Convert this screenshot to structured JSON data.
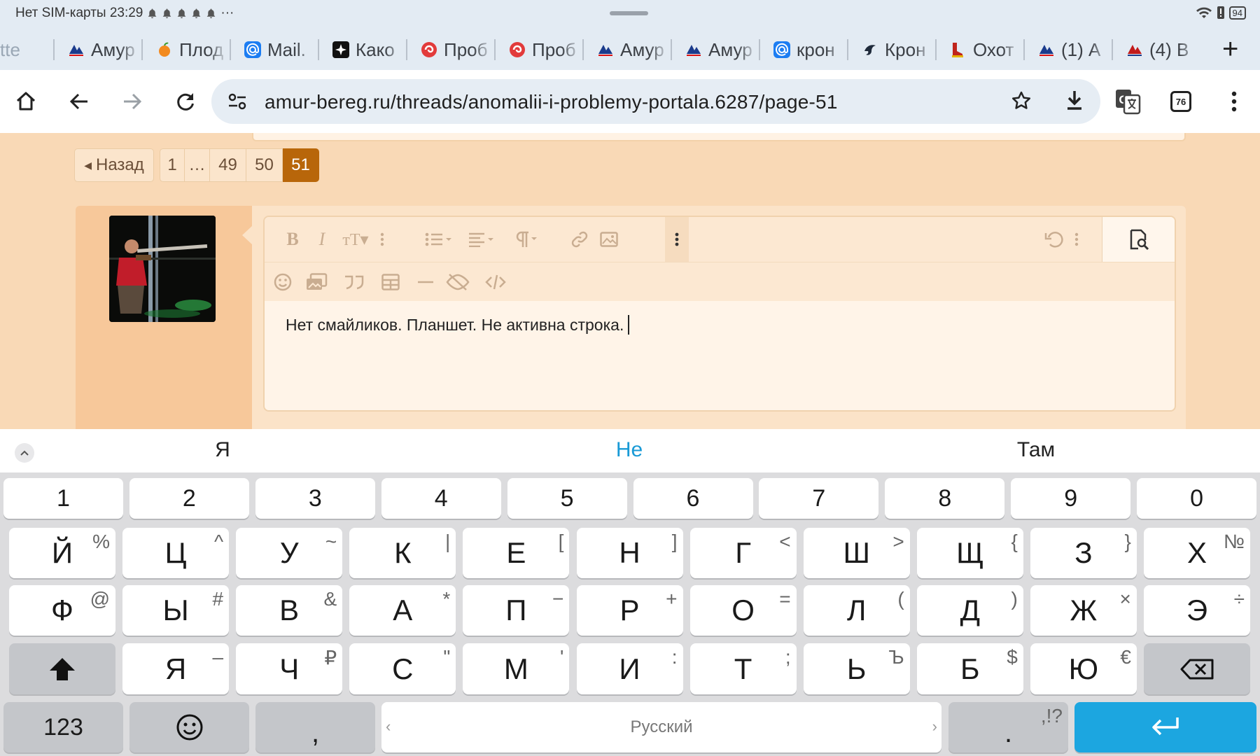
{
  "status": {
    "left_text": "Нет SIM-карты 23:29",
    "more": "···",
    "battery": "94"
  },
  "tabs": [
    {
      "title": "tte",
      "icon": "none"
    },
    {
      "title": "Амур",
      "icon": "amur-icon"
    },
    {
      "title": "Плод",
      "icon": "apple-icon"
    },
    {
      "title": "Mail.",
      "icon": "mail-at-icon"
    },
    {
      "title": "Како",
      "icon": "sparkle-icon"
    },
    {
      "title": "Проб",
      "icon": "red-swirl-icon"
    },
    {
      "title": "Проб",
      "icon": "red-swirl-icon"
    },
    {
      "title": "Амур",
      "icon": "amur-icon"
    },
    {
      "title": "Амур",
      "icon": "amur-icon"
    },
    {
      "title": "крон",
      "icon": "mail-at-icon"
    },
    {
      "title": "Крон",
      "icon": "bird-icon"
    },
    {
      "title": "Охот",
      "icon": "boot-icon"
    },
    {
      "title": "(1) А",
      "icon": "amur-icon"
    },
    {
      "title": "(4) В",
      "icon": "amur-red-icon"
    }
  ],
  "toolbar": {
    "url": "amur-bereg.ru/threads/anomalii-i-problemy-portala.6287/page-51",
    "tab_count": "76"
  },
  "pager": {
    "back": "Назад",
    "pages": [
      "1",
      "…",
      "49",
      "50",
      "51"
    ],
    "current": "51"
  },
  "editor": {
    "text": "Нет смайликов. Планшет. Не активна строка."
  },
  "keyboard": {
    "suggestions": [
      "Я",
      "Не",
      "Там"
    ],
    "numbers": [
      "1",
      "2",
      "3",
      "4",
      "5",
      "6",
      "7",
      "8",
      "9",
      "0"
    ],
    "row1": [
      [
        "Й",
        "%"
      ],
      [
        "Ц",
        "^"
      ],
      [
        "У",
        "~"
      ],
      [
        "К",
        "|"
      ],
      [
        "Е",
        "["
      ],
      [
        "Н",
        "]"
      ],
      [
        "Г",
        "<"
      ],
      [
        "Ш",
        ">"
      ],
      [
        "Щ",
        "{"
      ],
      [
        "З",
        "}"
      ],
      [
        "Х",
        "№"
      ]
    ],
    "row2": [
      [
        "Ф",
        "@"
      ],
      [
        "Ы",
        "#"
      ],
      [
        "В",
        "&"
      ],
      [
        "А",
        "*"
      ],
      [
        "П",
        "−"
      ],
      [
        "Р",
        "+"
      ],
      [
        "О",
        "="
      ],
      [
        "Л",
        "("
      ],
      [
        "Д",
        ")"
      ],
      [
        "Ж",
        "×"
      ],
      [
        "Э",
        "÷"
      ]
    ],
    "row3": [
      [
        "Я",
        "–"
      ],
      [
        "Ч",
        "₽"
      ],
      [
        "С",
        "\""
      ],
      [
        "М",
        "'"
      ],
      [
        "И",
        ":"
      ],
      [
        "Т",
        ";"
      ],
      [
        "Ь",
        "Ъ"
      ],
      [
        "Б",
        "$"
      ],
      [
        "Ю",
        "€"
      ]
    ],
    "bottom": {
      "num_key": "123",
      "comma": ",",
      "space": "Русский",
      "period": ".",
      "period_sub": ",!?"
    }
  }
}
